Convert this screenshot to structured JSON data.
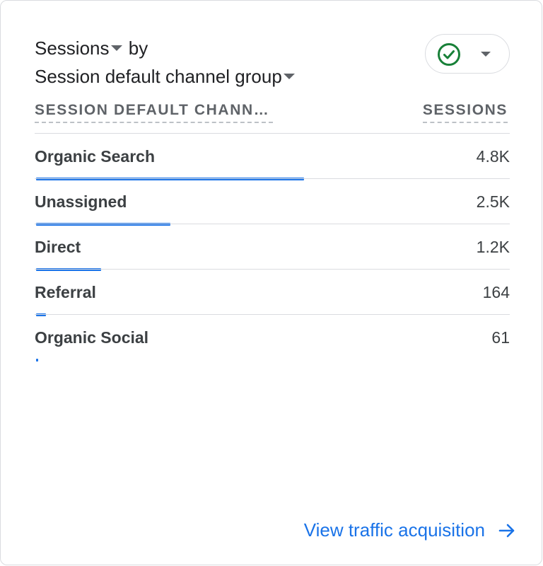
{
  "card": {
    "metric_label": "Sessions",
    "by_text": "by",
    "dimension_label": "Session default channel group"
  },
  "status": {
    "icon": "check-circle-icon",
    "color": "#188038"
  },
  "table": {
    "dimension_header": "SESSION DEFAULT CHANN…",
    "metric_header": "SESSIONS",
    "rows": [
      {
        "label": "Organic Search",
        "value": "4.8K",
        "share": 0.5833
      },
      {
        "label": "Unassigned",
        "value": "2.5K",
        "share": 0.2917
      },
      {
        "label": "Direct",
        "value": "1.2K",
        "share": 0.1417
      },
      {
        "label": "Referral",
        "value": "164",
        "share": 0.0208
      },
      {
        "label": "Organic Social",
        "value": "61",
        "share": 0.0042
      }
    ]
  },
  "footer": {
    "link_label": "View traffic acquisition",
    "link_icon": "arrow-right-icon"
  },
  "colors": {
    "accent": "#1a73e8",
    "text": "#202124",
    "muted": "#5f6368",
    "divider": "#dadce0"
  }
}
